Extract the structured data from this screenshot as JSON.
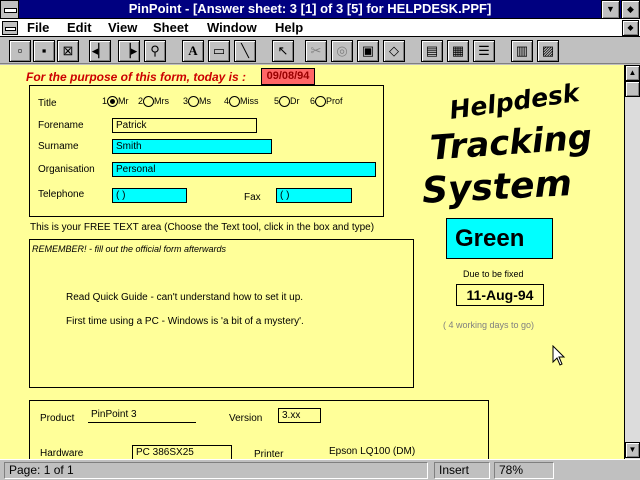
{
  "window": {
    "title": "PinPoint - [Answer sheet: 3 [1] of 3 [5] for HELPDESK.PPF]"
  },
  "menu": [
    "File",
    "Edit",
    "View",
    "Sheet",
    "Window",
    "Help"
  ],
  "toolbar": {
    "tools": [
      "new-icon",
      "save-icon",
      "close-icon",
      "prev-icon",
      "next-icon",
      "find-icon",
      "text-tool-icon",
      "box-tool-icon",
      "line-tool-icon",
      "pointer-icon",
      "cut-icon",
      "copy-icon",
      "paste-icon",
      "eraser-icon",
      "form-icon",
      "sheet-icon",
      "list-icon",
      "clipboard-icon",
      "chart-icon"
    ],
    "text_tool_glyph": "A"
  },
  "form": {
    "purpose_label": "For the purpose of this form, today is :",
    "today_value": "09/08/94",
    "title_label": "Title",
    "titles": [
      {
        "num": "1",
        "label": "Mr",
        "selected": true
      },
      {
        "num": "2",
        "label": "Mrs",
        "selected": false
      },
      {
        "num": "3",
        "label": "Ms",
        "selected": false
      },
      {
        "num": "4",
        "label": "Miss",
        "selected": false
      },
      {
        "num": "5",
        "label": "Dr",
        "selected": false
      },
      {
        "num": "6",
        "label": "Prof",
        "selected": false
      }
    ],
    "forename_label": "Forename",
    "forename_value": "Patrick",
    "surname_label": "Surname",
    "surname_value": "Smith",
    "organisation_label": "Organisation",
    "organisation_value": "Personal",
    "telephone_label": "Telephone",
    "telephone_value": "(      )",
    "fax_label": "Fax",
    "fax_value": "(      )",
    "free_text_label": "This is your FREE TEXT area (Choose the Text tool, click in the box and type)",
    "remember_text": "REMEMBER! - fill out the official form afterwards",
    "note1": "Read Quick Guide - can't understand how to set it up.",
    "note2": "First time using a PC - Windows is 'a bit of a mystery'.",
    "product_label": "Product",
    "product_value": "PinPoint 3",
    "version_label": "Version",
    "version_value": "3.xx",
    "hardware_label": "Hardware",
    "hardware_value": "PC 386SX25",
    "printer_label": "Printer",
    "printer_value": "Epson LQ100 (DM)"
  },
  "logo": {
    "line1": "Helpdesk",
    "line2": "Tracking",
    "line3": "System"
  },
  "side": {
    "status_value": "Green",
    "due_label": "Due to be fixed",
    "due_date": "11-Aug-94",
    "working_days": "( 4 working days to go)"
  },
  "statusbar": {
    "page": "Page: 1 of 1",
    "mode": "Insert",
    "zoom": "78%"
  }
}
